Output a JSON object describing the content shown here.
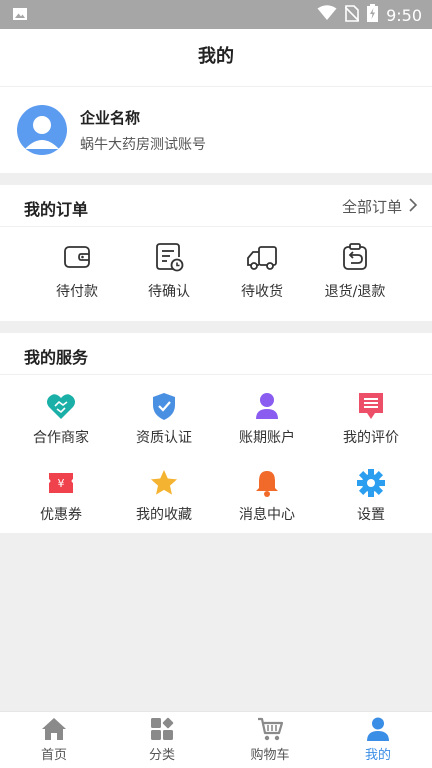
{
  "status_bar": {
    "time": "9:50"
  },
  "header": {
    "title": "我的"
  },
  "profile": {
    "company_label": "企业名称",
    "account_name": "蜗牛大药房测试账号"
  },
  "orders": {
    "title": "我的订单",
    "all_label": "全部订单",
    "items": [
      {
        "label": "待付款",
        "icon": "wallet-icon"
      },
      {
        "label": "待确认",
        "icon": "document-clock-icon"
      },
      {
        "label": "待收货",
        "icon": "truck-icon"
      },
      {
        "label": "退货/退款",
        "icon": "return-box-icon"
      }
    ]
  },
  "services": {
    "title": "我的服务",
    "items": [
      {
        "label": "合作商家",
        "icon": "handshake-heart-icon",
        "color": "#1ab0a8"
      },
      {
        "label": "资质认证",
        "icon": "shield-check-icon",
        "color": "#4a90e2"
      },
      {
        "label": "账期账户",
        "icon": "user-icon",
        "color": "#8a5cf0"
      },
      {
        "label": "我的评价",
        "icon": "comment-icon",
        "color": "#ee4f68"
      },
      {
        "label": "优惠券",
        "icon": "coupon-icon",
        "color": "#f0424c"
      },
      {
        "label": "我的收藏",
        "icon": "star-icon",
        "color": "#f5b332"
      },
      {
        "label": "消息中心",
        "icon": "bell-icon",
        "color": "#f26a2a"
      },
      {
        "label": "设置",
        "icon": "gear-icon",
        "color": "#2b9ef0"
      }
    ]
  },
  "tabs": [
    {
      "label": "首页",
      "icon": "home-icon"
    },
    {
      "label": "分类",
      "icon": "category-icon"
    },
    {
      "label": "购物车",
      "icon": "cart-icon"
    },
    {
      "label": "我的",
      "icon": "person-icon"
    }
  ],
  "colors": {
    "accent": "#3a8ee6",
    "tab_inactive": "#8a8a8a"
  }
}
